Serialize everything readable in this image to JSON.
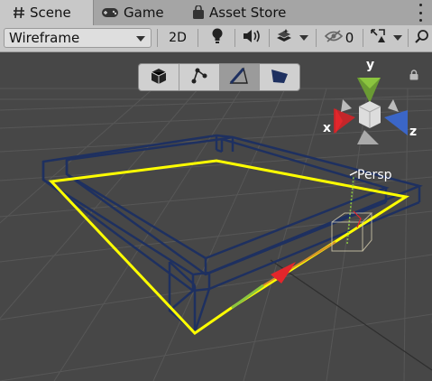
{
  "tabs": [
    {
      "label": "Scene",
      "icon": "hash-icon"
    },
    {
      "label": "Game",
      "icon": "gamepad-icon"
    },
    {
      "label": "Asset Store",
      "icon": "shopping-bag-icon"
    }
  ],
  "toolbar": {
    "draw_mode": "Wireframe",
    "mode_2d_label": "2D",
    "hidden_count": "0",
    "icons": [
      "lightbulb-icon",
      "audio-icon",
      "effects-icon",
      "visibility-icon",
      "gizmos-icon"
    ]
  },
  "scene_tools": [
    "object-mode-icon",
    "vertex-mode-icon",
    "edge-mode-icon",
    "face-mode-icon"
  ],
  "gizmo": {
    "x_label": "x",
    "y_label": "y",
    "z_label": "z",
    "projection": "Persp"
  },
  "colors": {
    "selection_outline": "#ffff00",
    "wireframe": "#1e3060",
    "axis_x": "#e3262b",
    "axis_y": "#8bc53f",
    "axis_z": "#3b66c7"
  }
}
